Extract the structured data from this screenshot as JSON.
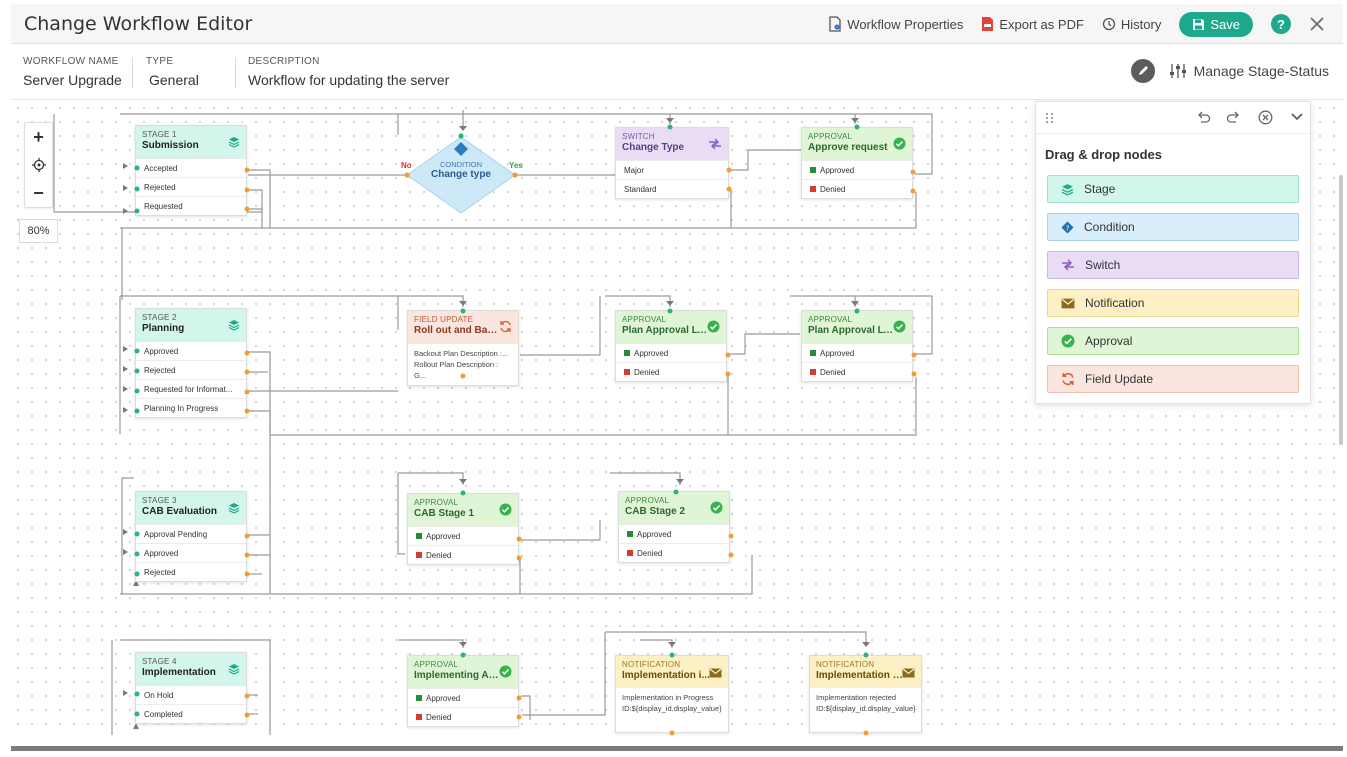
{
  "app": {
    "title": "Change Workflow Editor"
  },
  "toolbar": {
    "workflow_properties": "Workflow Properties",
    "export_pdf": "Export as PDF",
    "history": "History",
    "save": "Save",
    "help": "?"
  },
  "info": {
    "name_label": "WORKFLOW NAME",
    "name_value": "Server Upgrade",
    "type_label": "TYPE",
    "type_value": "General",
    "desc_label": "DESCRIPTION",
    "desc_value": "Workflow for updating the server",
    "manage": "Manage Stage-Status"
  },
  "zoom": {
    "plus": "+",
    "minus": "−",
    "level": "80%"
  },
  "palette": {
    "title": "Drag & drop nodes",
    "items": [
      {
        "label": "Stage",
        "bg": "#d3f6ec",
        "border": "#9fe3cf",
        "icon": "stage-icon"
      },
      {
        "label": "Condition",
        "bg": "#d9eefb",
        "border": "#a9d4ef",
        "icon": "condition-icon"
      },
      {
        "label": "Switch",
        "bg": "#e8ddf5",
        "border": "#cbb7e6",
        "icon": "switch-icon"
      },
      {
        "label": "Notification",
        "bg": "#fdf0c4",
        "border": "#efd68a",
        "icon": "notification-icon"
      },
      {
        "label": "Approval",
        "bg": "#dff5d6",
        "border": "#aee09a",
        "icon": "approval-icon"
      },
      {
        "label": "Field Update",
        "bg": "#fbe6df",
        "border": "#f0c0b0",
        "icon": "field-update-icon"
      }
    ]
  },
  "nodes": {
    "stage1": {
      "type": "STAGE 1",
      "name": "Submission",
      "rows": [
        "Accepted",
        "Rejected",
        "Requested"
      ]
    },
    "condition": {
      "type": "CONDITION",
      "name": "Change type",
      "no": "No",
      "yes": "Yes"
    },
    "switch": {
      "type": "SWITCH",
      "name": "Change Type",
      "rows": [
        "Major",
        "Standard"
      ]
    },
    "approval1": {
      "type": "APPROVAL",
      "name": "Approve request",
      "rows": [
        "Approved",
        "Denied"
      ]
    },
    "stage2": {
      "type": "STAGE 2",
      "name": "Planning",
      "rows": [
        "Approved",
        "Rejected",
        "Requested for Informat...",
        "Planning In Progress"
      ]
    },
    "field": {
      "type": "FIELD UPDATE",
      "name": "Roll out and Back...",
      "rows": [
        "Backout Plan Description :...",
        "Rollout Plan Description : G..."
      ]
    },
    "approval2": {
      "type": "APPROVAL",
      "name": "Plan Approval LVL 1",
      "rows": [
        "Approved",
        "Denied"
      ]
    },
    "approval3": {
      "type": "APPROVAL",
      "name": "Plan Approval LVL 2",
      "rows": [
        "Approved",
        "Denied"
      ]
    },
    "stage3": {
      "type": "STAGE 3",
      "name": "CAB Evaluation",
      "rows": [
        "Approval Pending",
        "Approved",
        "Rejected"
      ]
    },
    "cab1": {
      "type": "APPROVAL",
      "name": "CAB Stage 1",
      "rows": [
        "Approved",
        "Denied"
      ]
    },
    "cab2": {
      "type": "APPROVAL",
      "name": "CAB Stage 2",
      "rows": [
        "Approved",
        "Denied"
      ]
    },
    "stage4": {
      "type": "STAGE 4",
      "name": "Implementation",
      "rows": [
        "On Hold",
        "Completed"
      ]
    },
    "approval4": {
      "type": "APPROVAL",
      "name": "Implementing Ap...",
      "rows": [
        "Approved",
        "Denied"
      ]
    },
    "notif1": {
      "type": "NOTIFICATION",
      "name": "Implementation i...",
      "line1": "Implementation in Progress",
      "line2": "ID:${display_id.display_value}"
    },
    "notif2": {
      "type": "NOTIFICATION",
      "name": "Implementation R...",
      "line1": "Implementation rejected",
      "line2": "ID:${display_id.display_value}"
    }
  }
}
